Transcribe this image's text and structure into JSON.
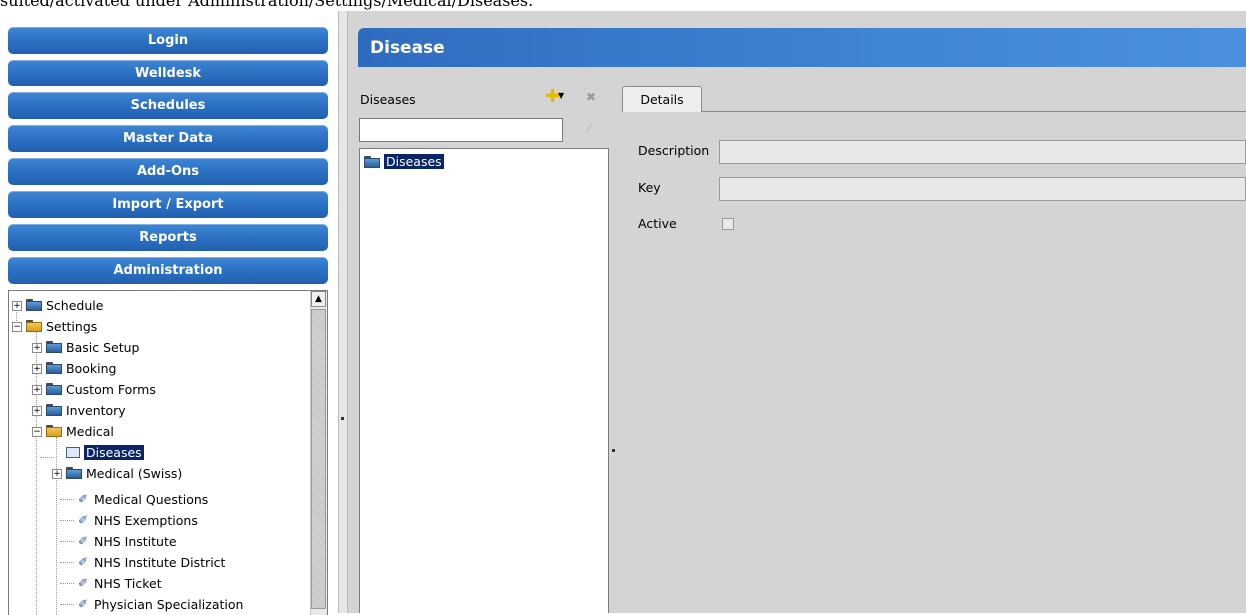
{
  "caption": "suited/activated under Administration/Settings/Medical/Diseases.",
  "nav": {
    "buttons": [
      "Login",
      "Welldesk",
      "Schedules",
      "Master Data",
      "Add-Ons",
      "Import / Export",
      "Reports",
      "Administration"
    ]
  },
  "tree": {
    "nodes": [
      {
        "label": "Schedule"
      },
      {
        "label": "Settings"
      },
      {
        "label": "Basic Setup"
      },
      {
        "label": "Booking"
      },
      {
        "label": "Custom Forms"
      },
      {
        "label": "Inventory"
      },
      {
        "label": "Medical"
      },
      {
        "label": "Diseases"
      },
      {
        "label": "Medical (Swiss)"
      },
      {
        "label": "Medical Questions"
      },
      {
        "label": "NHS Exemptions"
      },
      {
        "label": "NHS Institute"
      },
      {
        "label": "NHS Institute District"
      },
      {
        "label": "NHS Ticket"
      },
      {
        "label": "Physician Specialization"
      }
    ]
  },
  "header": {
    "title": "Disease"
  },
  "list": {
    "label": "Diseases",
    "search_value": "",
    "root_item": "Diseases"
  },
  "details": {
    "tab_label": "Details",
    "description_label": "Description",
    "description_value": "",
    "key_label": "Key",
    "key_value": "",
    "active_label": "Active",
    "active_checked": false
  }
}
